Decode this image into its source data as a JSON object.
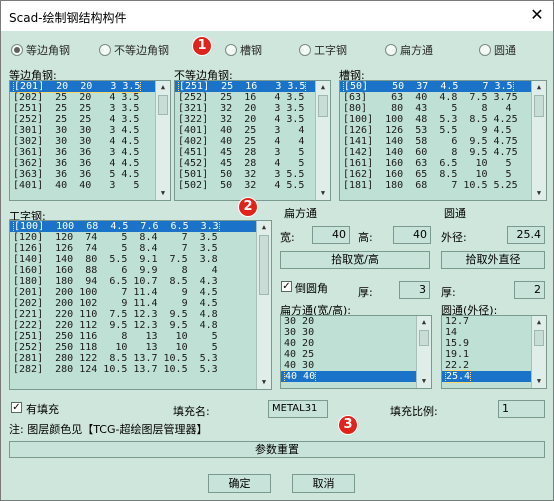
{
  "window": {
    "title": "Scad-绘制钢结构构件",
    "close_glyph": "✕"
  },
  "badges": [
    "1",
    "2",
    "3"
  ],
  "section_types": [
    {
      "label": "等边角钢",
      "selected": true
    },
    {
      "label": "不等边角钢",
      "selected": false
    },
    {
      "label": "槽钢",
      "selected": false
    },
    {
      "label": "工字钢",
      "selected": false
    },
    {
      "label": "扁方通",
      "selected": false
    },
    {
      "label": "圆通",
      "selected": false
    }
  ],
  "equal_angle": {
    "label": "等边角钢:",
    "rows": [
      "[201]  20  20   3 3.5",
      "[202]  25  20   4 3.5",
      "[251]  25  25   3 3.5",
      "[252]  25  25   4 3.5",
      "[301]  30  30   3 4.5",
      "[302]  30  30   4 4.5",
      "[361]  36  36   3 4.5",
      "[362]  36  36   4 4.5",
      "[363]  36  36   5 4.5",
      "[401]  40  40   3   5"
    ],
    "selected_index": 0
  },
  "unequal_angle": {
    "label": "不等边角钢:",
    "rows": [
      "[251]  25  16   3 3.5",
      "[252]  25  16   4 3.5",
      "[321]  32  20   3 3.5",
      "[322]  32  20   4 3.5",
      "[401]  40  25   3   4",
      "[402]  40  25   4   4",
      "[451]  45  28   3   5",
      "[452]  45  28   4   5",
      "[501]  50  32   3 5.5",
      "[502]  50  32   4 5.5"
    ],
    "selected_index": 0
  },
  "channel": {
    "label": "槽钢:",
    "rows": [
      "[50]    50  37  4.5    7 3.5",
      "[63]    63  40  4.8  7.5 3.75",
      "[80]    80  43    5    8   4",
      "[100]  100  48  5.3  8.5 4.25",
      "[126]  126  53  5.5    9 4.5",
      "[141]  140  58    6  9.5 4.75",
      "[142]  140  60    8  9.5 4.75",
      "[161]  160  63  6.5   10   5",
      "[162]  160  65  8.5   10   5",
      "[181]  180  68    7 10.5 5.25"
    ],
    "selected_index": 0
  },
  "i_beam": {
    "label": "工字钢:",
    "rows": [
      "[100]  100  68  4.5  7.6  6.5  3.3",
      "[120]  120  74    5  8.4    7  3.5",
      "[126]  126  74    5  8.4    7  3.5",
      "[140]  140  80  5.5  9.1  7.5  3.8",
      "[160]  160  88    6  9.9    8    4",
      "[180]  180  94  6.5 10.7  8.5  4.3",
      "[201]  200 100    7 11.4    9  4.5",
      "[202]  200 102    9 11.4    9  4.5",
      "[221]  220 110  7.5 12.3  9.5  4.8",
      "[222]  220 112  9.5 12.3  9.5  4.8",
      "[251]  250 116    8   13   10    5",
      "[252]  250 118   10   13   10    5",
      "[281]  280 122  8.5 13.7 10.5  5.3",
      "[282]  280 124 10.5 13.7 10.5  5.3"
    ],
    "selected_index": 0
  },
  "flat_tube": {
    "group_label": "扁方通",
    "width_label": "宽:",
    "width_value": "40",
    "height_label": "高:",
    "height_value": "40",
    "pick_button": "拾取宽/高",
    "fillet_label": "倒圆角",
    "fillet_checked": true,
    "thickness_label": "厚:",
    "thickness_value": "3",
    "list_label": "扁方通(宽/高):",
    "rows": [
      "30 20",
      "30 30",
      "40 20",
      "40 25",
      "40 30",
      "40 40"
    ],
    "selected_index": 5
  },
  "round_tube": {
    "group_label": "圆通",
    "diameter_label": "外径:",
    "diameter_value": "25.4",
    "pick_button": "拾取外直径",
    "thickness_label": "厚:",
    "thickness_value": "2",
    "list_label": "圆通(外径):",
    "rows": [
      "12.7",
      "14",
      "15.9",
      "19.1",
      "22.2",
      "25.4"
    ],
    "selected_index": 5
  },
  "fill": {
    "has_fill_label": "有填充",
    "has_fill_checked": true,
    "name_label": "填充名:",
    "name_value": "METAL31",
    "scale_label": "填充比例:",
    "scale_value": "1"
  },
  "note": "注: 图层颜色见【TCG-超绘图层管理器】",
  "buttons": {
    "reset": "参数重置",
    "ok": "确定",
    "cancel": "取消"
  }
}
